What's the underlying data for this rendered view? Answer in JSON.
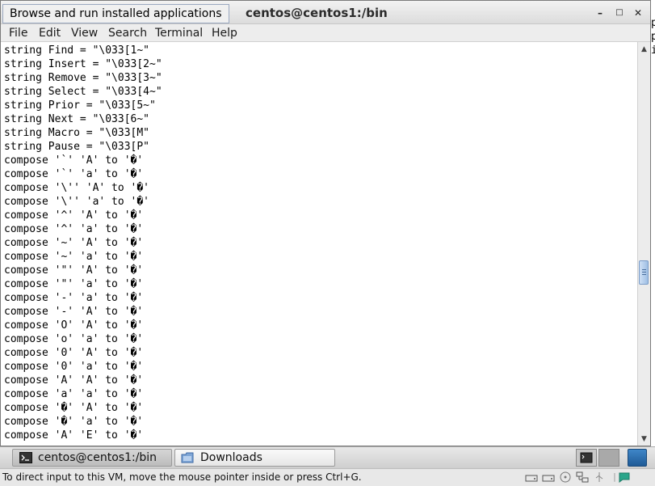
{
  "window": {
    "title": "centos@centos1:/bin",
    "tooltip": "Browse and run installed applications",
    "minimize": "–",
    "maximize": "□",
    "close": "✕"
  },
  "menu": [
    "File",
    "Edit",
    "View",
    "Search",
    "Terminal",
    "Help"
  ],
  "terminal_lines": [
    "string Find = \"\\033[1~\"",
    "string Insert = \"\\033[2~\"",
    "string Remove = \"\\033[3~\"",
    "string Select = \"\\033[4~\"",
    "string Prior = \"\\033[5~\"",
    "string Next = \"\\033[6~\"",
    "string Macro = \"\\033[M\"",
    "string Pause = \"\\033[P\"",
    "compose '`' 'A' to '�'",
    "compose '`' 'a' to '�'",
    "compose '\\'' 'A' to '�'",
    "compose '\\'' 'a' to '�'",
    "compose '^' 'A' to '�'",
    "compose '^' 'a' to '�'",
    "compose '~' 'A' to '�'",
    "compose '~' 'a' to '�'",
    "compose '\"' 'A' to '�'",
    "compose '\"' 'a' to '�'",
    "compose '-' 'a' to '�'",
    "compose '-' 'A' to '�'",
    "compose 'O' 'A' to '�'",
    "compose 'o' 'a' to '�'",
    "compose '0' 'A' to '�'",
    "compose '0' 'a' to '�'",
    "compose 'A' 'A' to '�'",
    "compose 'a' 'a' to '�'",
    "compose '�' 'A' to '�'",
    "compose '�' 'a' to '�'",
    "compose 'A' 'E' to '�'"
  ],
  "right_edge_chars": [
    "p",
    "p",
    "i"
  ],
  "taskbar": {
    "items": [
      {
        "label": "centos@centos1:/bin",
        "icon": "terminal-icon"
      },
      {
        "label": "Downloads",
        "icon": "folder-icon"
      }
    ]
  },
  "statusbar": {
    "text": "To direct input to this VM, move the mouse pointer inside or press Ctrl+G.",
    "icons": [
      "hdd-icon",
      "hdd-icon",
      "cdrom-icon",
      "usb-icon",
      "network-icon",
      "sound-icon",
      "vm-icon"
    ]
  },
  "colors": {
    "accent": "#7a9cc8",
    "terminal_bg": "#ffffff",
    "terminal_fg": "#000000"
  }
}
